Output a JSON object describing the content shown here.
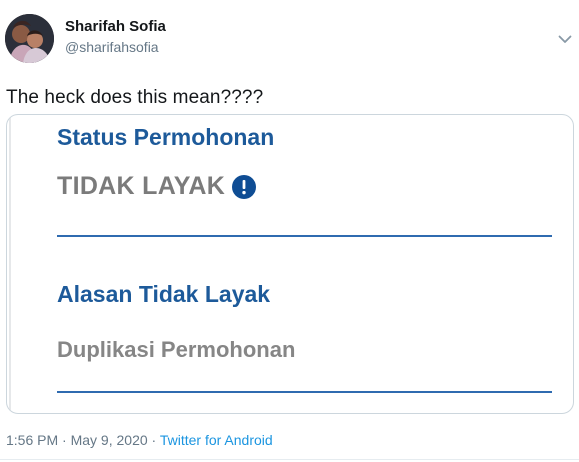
{
  "user": {
    "display_name": "Sharifah Sofia",
    "handle": "@sharifahsofia"
  },
  "tweet": {
    "text": "The heck does this mean????"
  },
  "media": {
    "status_label": "Status Permohonan",
    "status_value": "TIDAK LAYAK",
    "reason_label": "Alasan Tidak Layak",
    "reason_value": "Duplikasi Permohonan"
  },
  "meta": {
    "time": "1:56 PM",
    "separator": " · ",
    "date": "May 9, 2020",
    "source": "Twitter for Android"
  },
  "icons": {
    "more": "chevron-down-icon",
    "info": "info-icon"
  },
  "colors": {
    "form_label": "#1d5a9a",
    "form_rule": "#2f6bb0",
    "info_badge": "#0f4d94",
    "link": "#1b95e0"
  }
}
